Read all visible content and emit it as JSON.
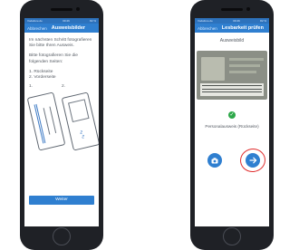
{
  "left_phone": {
    "status": {
      "carrier": "Vodafone.de",
      "time": "09:46",
      "battery": "82 %"
    },
    "nav": {
      "cancel_label": "Abbrechen",
      "title": "Ausweisbilder"
    },
    "instruction": "Im nächsten Schritt fotografieren Sie bitte Ihren Ausweis.",
    "sides_intro": "Bitte fotografieren Sie die folgenden Seiten:",
    "sides_list": [
      "1. Rückseite",
      "2. Vorderseite"
    ],
    "card_numbers": [
      "1.",
      "2."
    ],
    "button_label": "Weiter"
  },
  "right_phone": {
    "status": {
      "carrier": "Vodafone.de",
      "time": "09:46",
      "battery": "82 %"
    },
    "nav": {
      "cancel_label": "Abbrechen",
      "title": "Lesbarkeit prüfen"
    },
    "section_title": "Ausweisbild",
    "caption": "Personalausweis (Rückseite)"
  },
  "colors": {
    "accent": "#2f7fd0",
    "success": "#2ea84a",
    "highlight": "#e02d2d"
  },
  "icons": {
    "camera": "camera-icon",
    "next": "arrow-right-icon",
    "check": "check-icon"
  }
}
